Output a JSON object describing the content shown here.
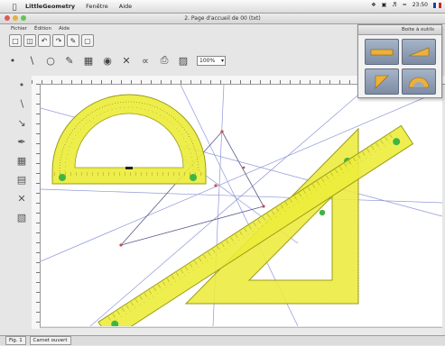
{
  "menubar": {
    "app_name": "LittleGeometry",
    "items": [
      "Fenêtre",
      "Aide"
    ],
    "status_time": "23:50"
  },
  "window": {
    "title": "2. Page d'accueil de 00 (txt)"
  },
  "app_menu": {
    "items": [
      "Fichier",
      "Édition",
      "Aide"
    ]
  },
  "toolbar": {
    "zoom_value": "100%"
  },
  "palette": {
    "title": "Boite à outils",
    "tools": [
      "ruler-icon",
      "set-square-icon",
      "triangle-icon",
      "protractor-icon"
    ]
  },
  "status_bar": {
    "tabs": [
      "Fig. 1",
      "Carnet ouvert"
    ]
  },
  "colors": {
    "instrument_yellow": "#ecec3c",
    "instrument_edge": "#9d9d17",
    "marker_green": "#3fb544",
    "construction_line": "#8d97d8",
    "palette_button": "#8d9bb4"
  }
}
